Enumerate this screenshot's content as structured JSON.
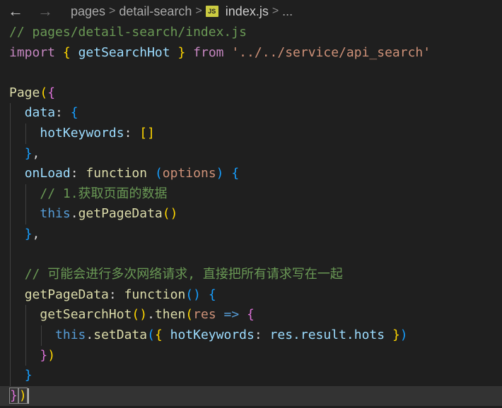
{
  "breadcrumb": {
    "back_icon": "←",
    "forward_icon": "→",
    "segments": [
      "pages",
      "detail-search",
      "index.js",
      "..."
    ],
    "separator": ">",
    "file_badge": "JS"
  },
  "code": {
    "comment_path": "// pages/detail-search/index.js",
    "import_kw": "import",
    "import_name": "getSearchHot",
    "from_kw": "from",
    "import_path": "'../../service/api_search'",
    "page_fn": "Page",
    "data_key": "data",
    "hot_keywords": "hotKeywords",
    "onload_key": "onLoad",
    "function_kw": "function",
    "options_param": "options",
    "comment_step": "// 1.获取页面的数据",
    "this_kw": "this",
    "get_page_data": "getPageData",
    "comment_merge": "// 可能会进行多次网络请求, 直接把所有请求写在一起",
    "get_search_hot": "getSearchHot",
    "then_fn": "then",
    "res_param": "res",
    "arrow": "=>",
    "set_data": "setData",
    "res_result_hots": "res.result.hots"
  }
}
